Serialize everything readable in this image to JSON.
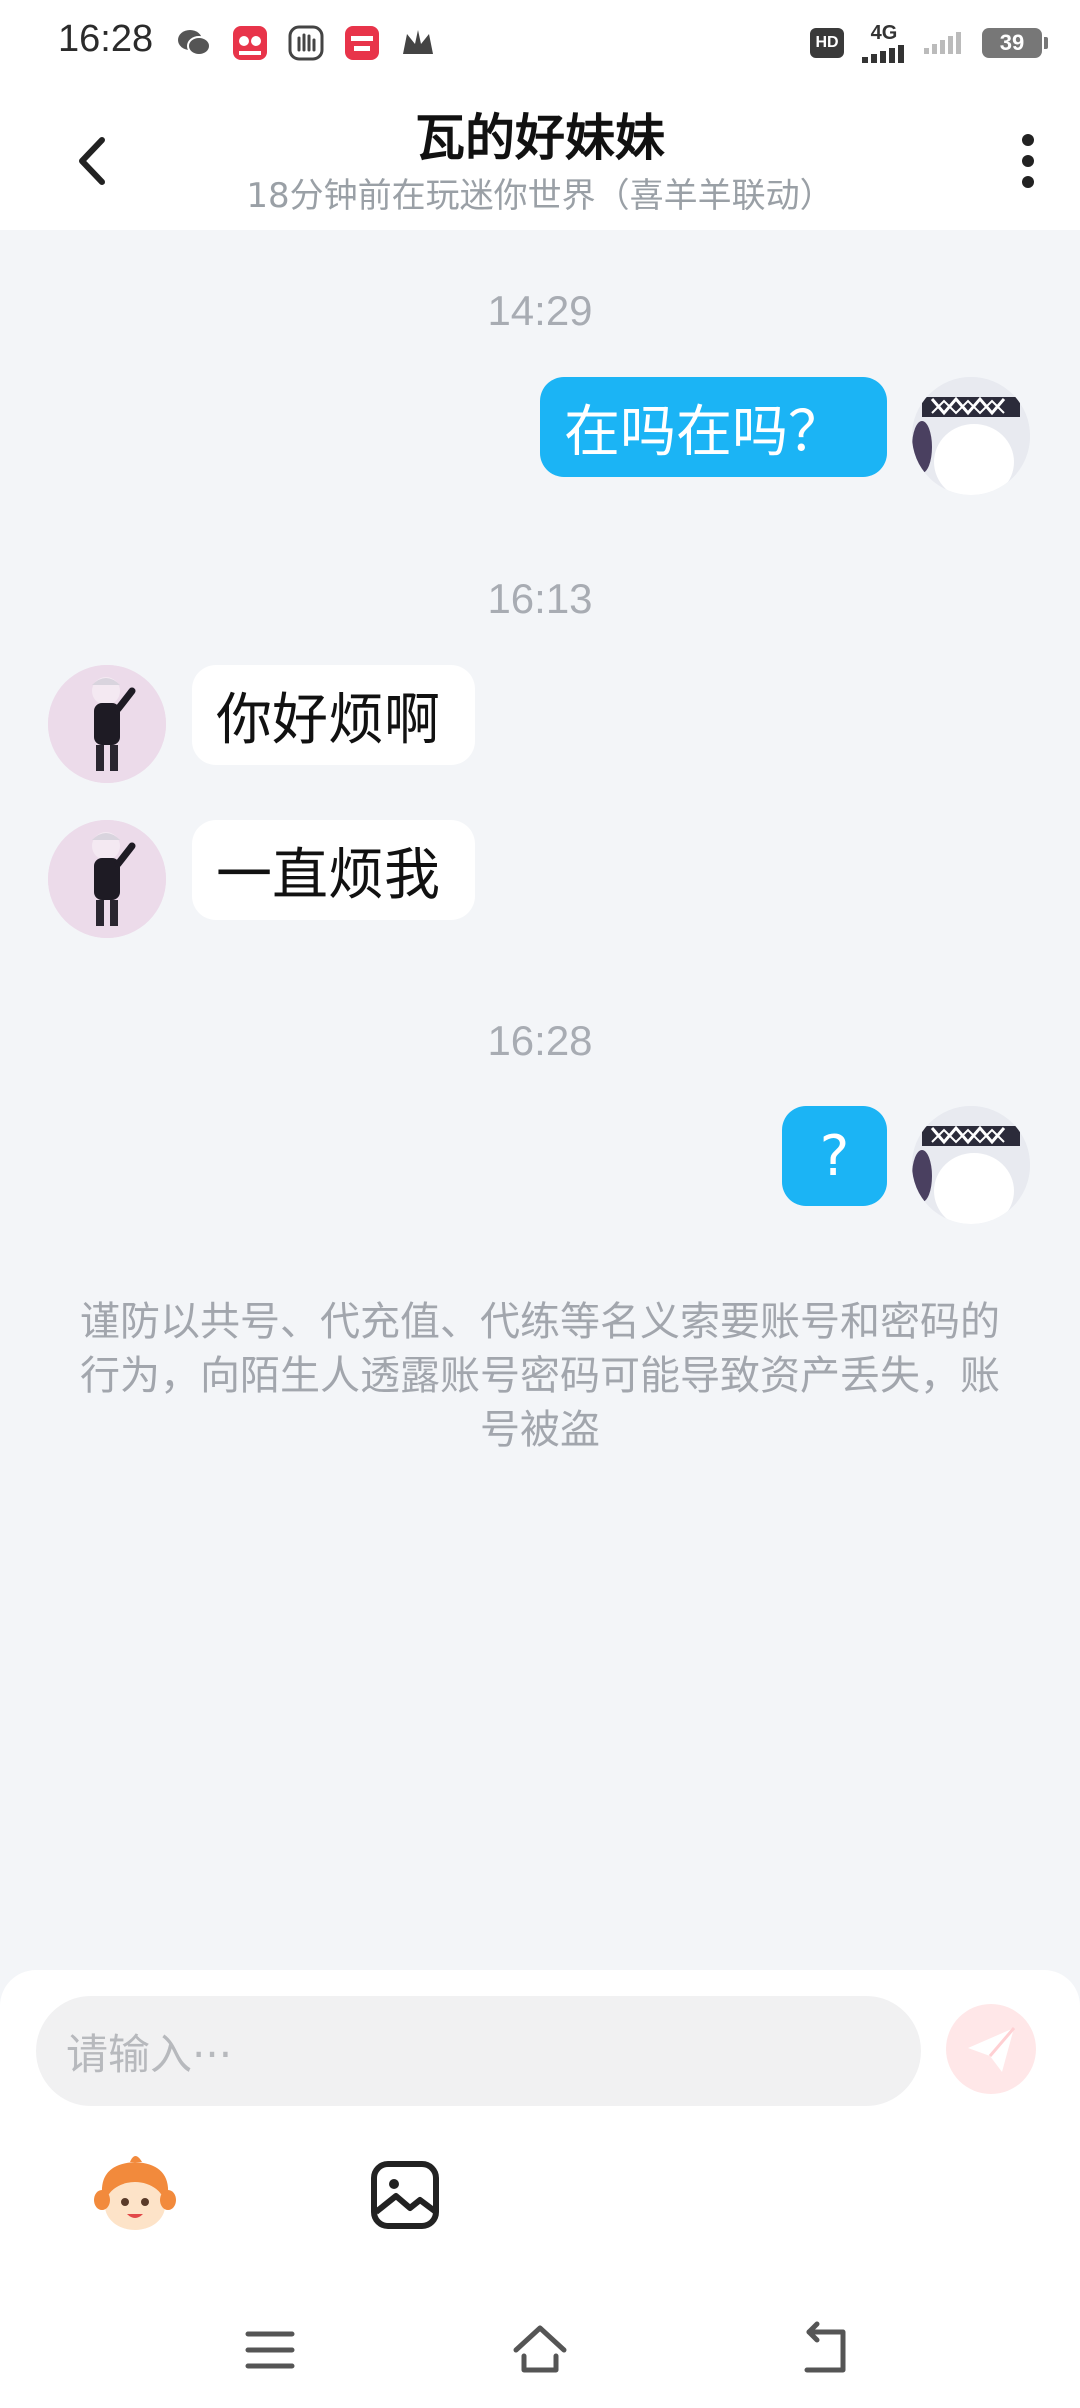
{
  "status_bar": {
    "time": "16:28",
    "notification_icons": [
      "wechat-icon",
      "app-red-icon",
      "hand-icon",
      "app-red2-icon",
      "crown-icon"
    ],
    "hd_badge": "HD",
    "network": "4G",
    "battery": "39"
  },
  "header": {
    "title": "瓦的好妹妹",
    "subtitle": "18分钟前在玩迷你世界（喜羊羊联动）"
  },
  "messages": [
    {
      "time": "14:29"
    },
    {
      "sender": "me",
      "text": "在吗在吗？"
    },
    {
      "time": "16:13"
    },
    {
      "sender": "other",
      "text": "你好烦啊"
    },
    {
      "sender": "other",
      "text": "一直烦我"
    },
    {
      "time": "16:28"
    },
    {
      "sender": "me",
      "text": "?"
    }
  ],
  "warning_text": "谨防以共号、代充值、代练等名义索要账号和密码的行为，向陌生人透露账号密码可能导致资产丢失，账号被盗",
  "input": {
    "placeholder": "请输入···"
  },
  "colors": {
    "my_bubble": "#1bb4f5",
    "other_bubble": "#ffffff",
    "background": "#f3f5f8",
    "send_button": "#ffe7e8"
  }
}
